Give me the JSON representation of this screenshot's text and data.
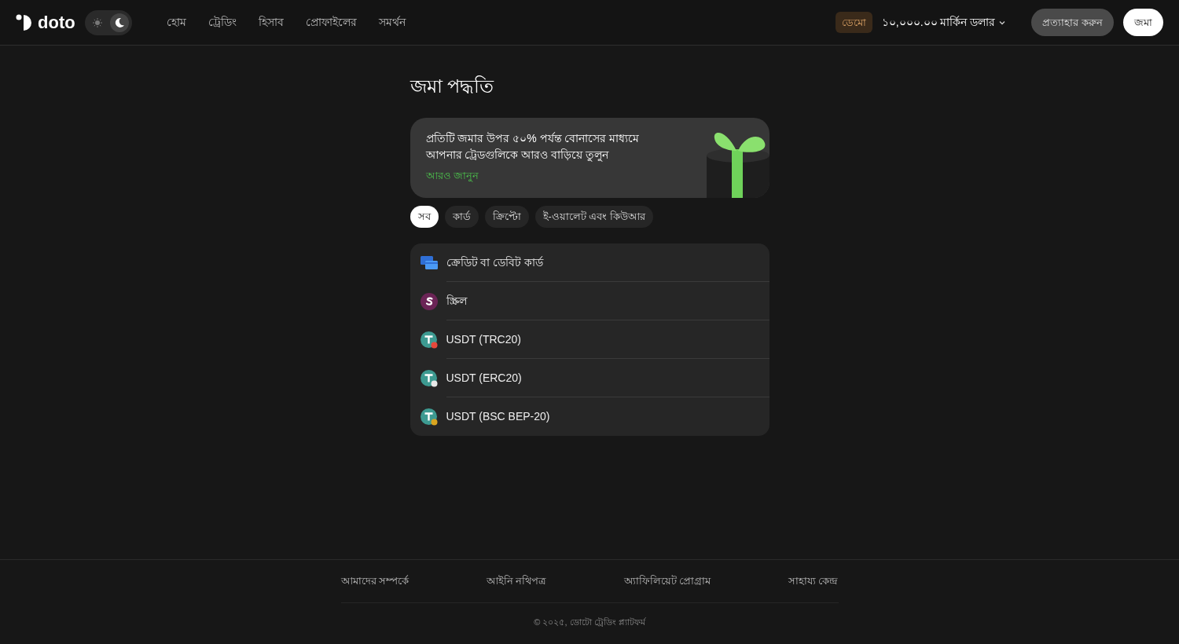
{
  "header": {
    "logo": "doto",
    "theme": {
      "dark": true
    },
    "nav": [
      {
        "label": "হোম"
      },
      {
        "label": "ট্রেডিং"
      },
      {
        "label": "হিসাব"
      },
      {
        "label": "প্রোফাইলের"
      },
      {
        "label": "সমর্থন"
      }
    ],
    "account_badge": "ডেমো",
    "balance": "১০,০০০.০০ মার্কিন ডলার",
    "withdraw_button": "প্রত্যাহার করুন",
    "deposit_button": "জমা"
  },
  "page_title": "জমা পদ্ধতি",
  "promo": {
    "text": "প্রতিটি জমার উপর ৫০% পর্যন্ত বোনাসের মাধ্যমে আপনার ট্রেডগুলিকে আরও বাড়িয়ে তুলুন",
    "link": "আরও জানুন"
  },
  "filters": [
    {
      "label": "সব",
      "selected": true
    },
    {
      "label": "কার্ড",
      "selected": false
    },
    {
      "label": "ক্রিপ্টো",
      "selected": false
    },
    {
      "label": "ই-ওয়ালেট এবং কিউআর",
      "selected": false
    }
  ],
  "methods": [
    {
      "kind": "card",
      "name": "ক্রেডিট বা ডেবিট কার্ড"
    },
    {
      "kind": "skrill",
      "name": "স্ক্রিল"
    },
    {
      "kind": "usdt",
      "name": "USDT (TRC20)",
      "color": "#e5483b"
    },
    {
      "kind": "usdt",
      "name": "USDT (ERC20)",
      "color": "#e8e8e8"
    },
    {
      "kind": "usdt",
      "name": "USDT (BSC BEP-20)",
      "color": "#d9a520"
    }
  ],
  "footer": {
    "links": [
      {
        "label": "আমাদের সম্পর্কে"
      },
      {
        "label": "আইনি নথিপত্র"
      },
      {
        "label": "অ্যাফিলিয়েট প্রোগ্রাম"
      },
      {
        "label": "সাহায্য কেন্দ্র"
      }
    ],
    "copyright": "© ২০২৫, ডোটো ট্রেডিং প্ল্যাটফর্ম"
  }
}
